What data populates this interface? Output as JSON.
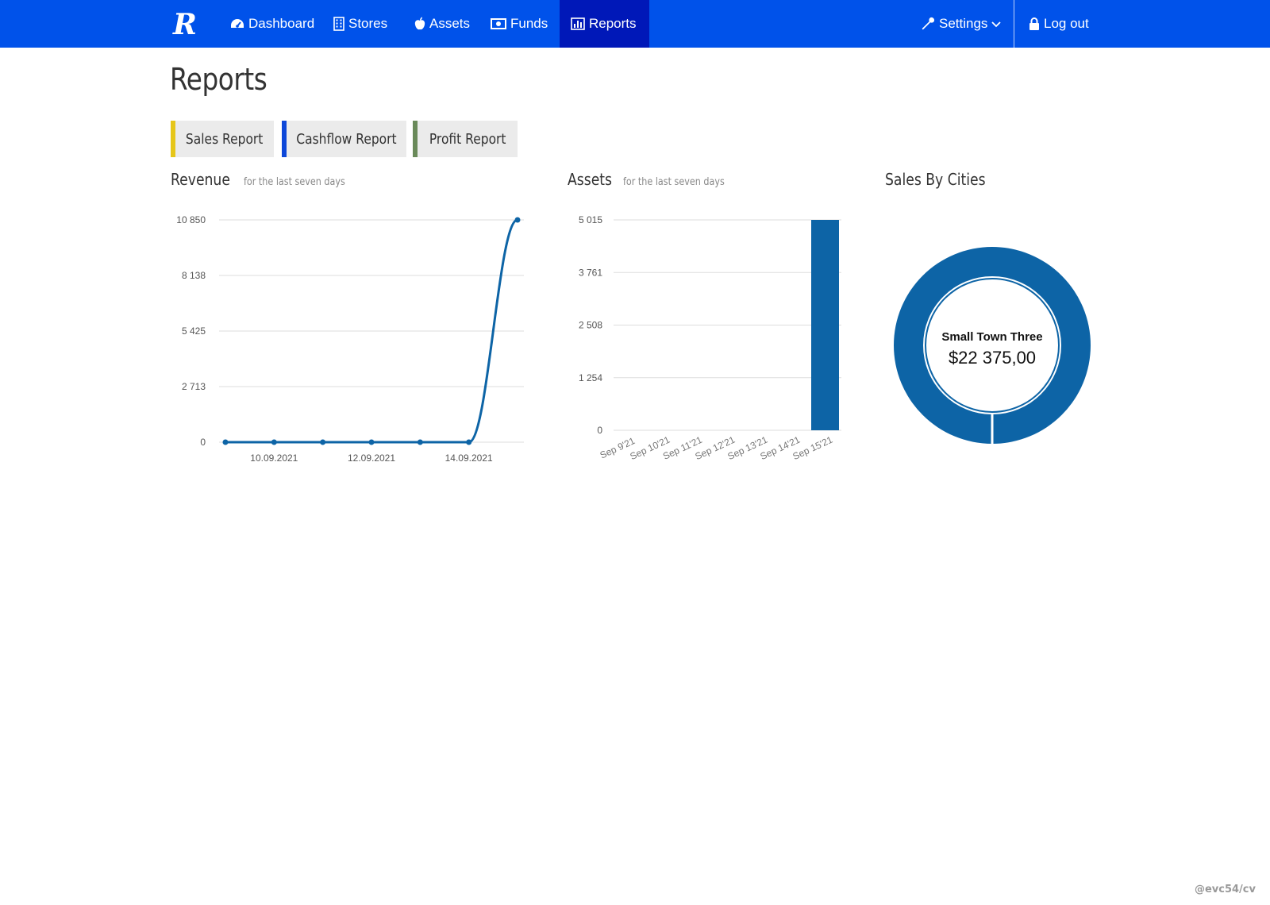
{
  "navbar": {
    "logo_letter": "R",
    "items": [
      {
        "label": "Dashboard",
        "icon": "tachometer-icon"
      },
      {
        "label": "Stores",
        "icon": "building-icon"
      },
      {
        "label": "Assets",
        "icon": "apple-icon"
      },
      {
        "label": "Funds",
        "icon": "money-icon"
      },
      {
        "label": "Reports",
        "icon": "bar-chart-icon",
        "active": true
      }
    ],
    "settings_label": "Settings",
    "logout_label": "Log out",
    "color": "#0052ea",
    "active_color": "#0018b8"
  },
  "page": {
    "title": "Reports"
  },
  "tabs": [
    {
      "label": "Sales Report",
      "accent": "#e6c619"
    },
    {
      "label": "Cashflow Report",
      "accent": "#0d47d9"
    },
    {
      "label": "Profit Report",
      "accent": "#6a8a5a"
    }
  ],
  "sections": {
    "revenue": {
      "title": "Revenue",
      "subtitle": "for the last seven days"
    },
    "assets": {
      "title": "Assets",
      "subtitle": "for the last seven days"
    },
    "cities": {
      "title": "Sales By Cities"
    }
  },
  "chart_data": [
    {
      "type": "line",
      "title": "Revenue",
      "x": [
        "2021-09-09",
        "2021-09-10",
        "2021-09-11",
        "2021-09-12",
        "2021-09-13",
        "2021-09-14",
        "2021-09-15"
      ],
      "x_tick_labels": [
        "10.09.2021",
        "12.09.2021",
        "14.09.2021"
      ],
      "values": [
        0,
        0,
        0,
        0,
        0,
        0,
        10850
      ],
      "y_ticks": [
        "0",
        "2 713",
        "5 425",
        "8 138",
        "10 850"
      ],
      "ylim": [
        0,
        10850
      ],
      "grid": true,
      "color": "#0d64a6"
    },
    {
      "type": "bar",
      "title": "Assets",
      "categories": [
        "Sep 9'21",
        "Sep 10'21",
        "Sep 11'21",
        "Sep 12'21",
        "Sep 13'21",
        "Sep 14'21",
        "Sep 15'21"
      ],
      "values": [
        0,
        0,
        0,
        0,
        0,
        0,
        5015
      ],
      "y_ticks": [
        "0",
        "1 254",
        "2 508",
        "3 761",
        "5 015"
      ],
      "ylim": [
        0,
        5015
      ],
      "grid": true,
      "color": "#0d64a6"
    },
    {
      "type": "pie",
      "title": "Sales By Cities",
      "slices": [
        {
          "label": "Small Town Three",
          "value": 22375
        }
      ],
      "center_label": "Small Town Three",
      "center_value": "$22 375,00",
      "color": "#0d64a6"
    }
  ],
  "footer": {
    "watermark": "@evc54/cv"
  }
}
